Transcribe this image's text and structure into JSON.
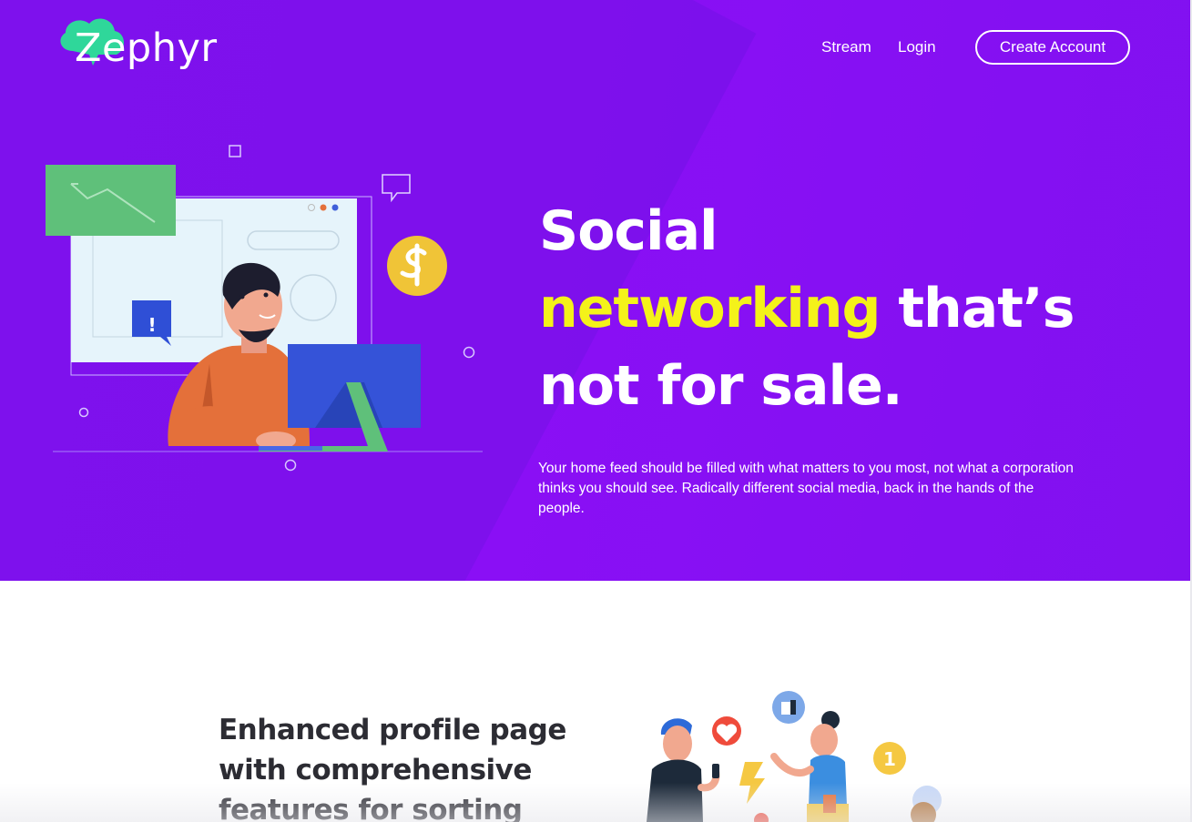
{
  "brand": {
    "name": "Zephyr",
    "logo_color": "#2fd79a"
  },
  "nav": {
    "links": [
      {
        "label": "Stream"
      },
      {
        "label": "Login"
      }
    ],
    "cta_label": "Create Account"
  },
  "hero": {
    "headline_line1": "Social",
    "headline_highlight": "networking",
    "headline_rest": "that’s not for sale.",
    "description": "Your home feed should be filled with what matters to you most, not what a corporation thinks you should see. Radically different social media, back in the hands of the people.",
    "background_color": "#8a10f6",
    "highlight_color": "#f4f21a",
    "illustration_badge": "!",
    "illustration_icon": "dollar-coin-icon"
  },
  "feature": {
    "title": "Enhanced profile page with comprehensive features for sorting",
    "illustration_badge": "1",
    "illustration_icons": [
      "heart-icon",
      "thumbs-up-icon",
      "lightning-icon"
    ]
  }
}
